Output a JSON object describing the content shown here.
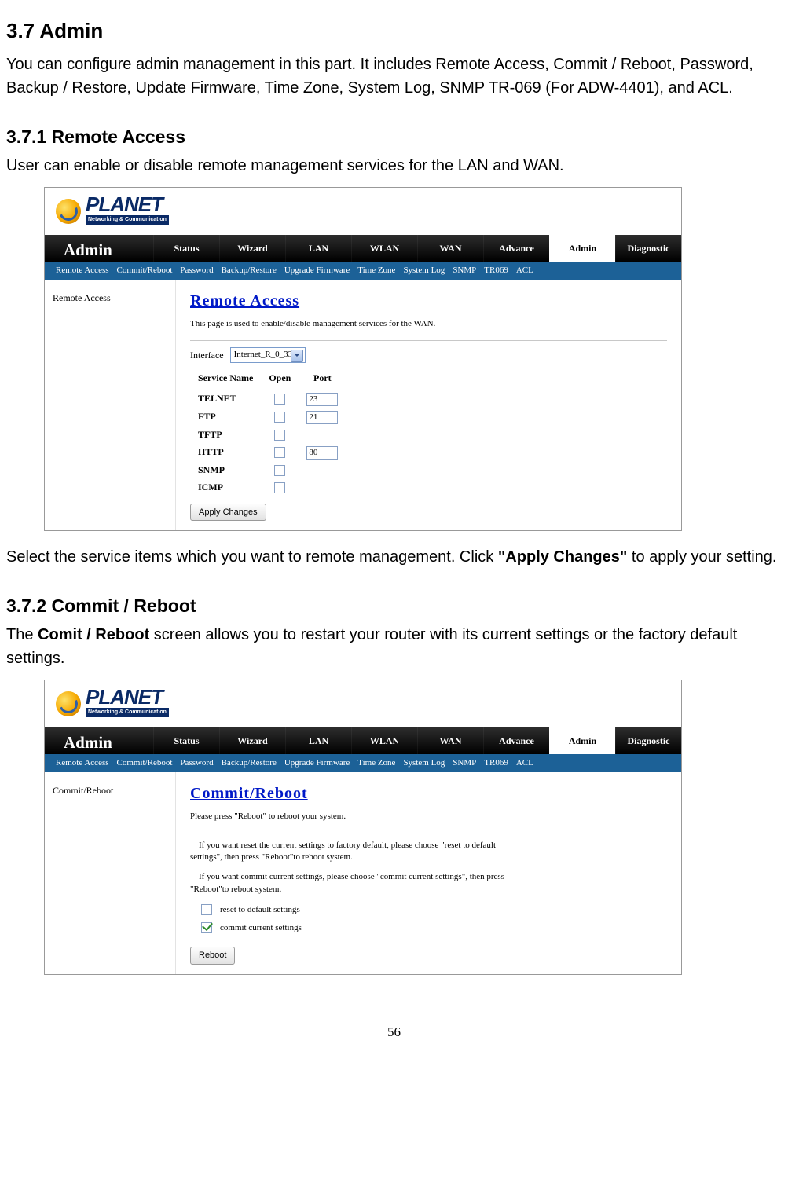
{
  "section": {
    "number_title": "3.7 Admin",
    "intro": "You can configure admin management in this part. It includes Remote Access, Commit / Reboot, Password, Backup / Restore, Update Firmware, Time Zone, System Log, SNMP TR-069 (For ADW-4401), and ACL."
  },
  "sub1": {
    "title": "3.7.1 Remote Access",
    "lead": "User can enable or disable remote management services for the LAN and WAN.",
    "after_before": "Select the service items which you want to remote management. Click ",
    "after_bold": "\"Apply Changes\"",
    "after_after": " to apply your setting."
  },
  "sub2": {
    "title": "3.7.2 Commit / Reboot",
    "lead_before": "The ",
    "lead_bold": "Comit / Reboot",
    "lead_after": " screen allows you to restart your router with its current settings or the factory default settings."
  },
  "shot_common": {
    "logo_text": "PLANET",
    "logo_sub": "Networking & Communication",
    "brand": "Admin",
    "tabs": [
      "Status",
      "Wizard",
      "LAN",
      "WLAN",
      "WAN",
      "Advance",
      "Admin",
      "Diagnostic"
    ],
    "active_tab": "Admin",
    "subnav": [
      "Remote Access",
      "Commit/Reboot",
      "Password",
      "Backup/Restore",
      "Upgrade Firmware",
      "Time Zone",
      "System Log",
      "SNMP",
      "TR069",
      "ACL"
    ]
  },
  "shot1": {
    "sidebar": "Remote Access",
    "title": "Remote Access",
    "hint": "This page is used to enable/disable management services for the WAN.",
    "iface_label": "Interface",
    "iface_value": "Internet_R_0_33",
    "cols": [
      "Service Name",
      "Open",
      "Port"
    ],
    "rows": [
      {
        "name": "TELNET",
        "open": false,
        "port": "23"
      },
      {
        "name": "FTP",
        "open": false,
        "port": "21"
      },
      {
        "name": "TFTP",
        "open": false,
        "port": ""
      },
      {
        "name": "HTTP",
        "open": false,
        "port": "80"
      },
      {
        "name": "SNMP",
        "open": false,
        "port": ""
      },
      {
        "name": "ICMP",
        "open": false,
        "port": ""
      }
    ],
    "apply": "Apply Changes"
  },
  "shot2": {
    "sidebar": "Commit/Reboot",
    "title": "Commit/Reboot",
    "hint": "Please press \"Reboot\" to reboot your system.",
    "note1": "If you want reset the current settings to factory default, please choose \"reset to default settings\", then press \"Reboot\"to reboot system.",
    "note2": "If you want commit current settings, please choose \"commit current settings\", then press \"Reboot\"to reboot system.",
    "opt1": {
      "label": "reset to default settings",
      "checked": false
    },
    "opt2": {
      "label": "commit current settings",
      "checked": true
    },
    "reboot": "Reboot"
  },
  "pagenum": "56"
}
